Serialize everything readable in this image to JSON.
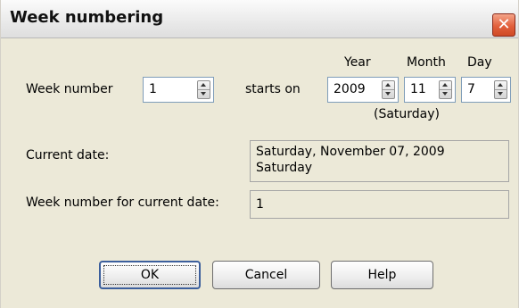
{
  "window": {
    "title": "Week numbering",
    "close_symbol": "✕"
  },
  "week_number": {
    "label": "Week number",
    "value": "1"
  },
  "start": {
    "label": "starts on",
    "year_header": "Year",
    "month_header": "Month",
    "day_header": "Day",
    "year": "2009",
    "month": "11",
    "day": "7",
    "weekday": "(Saturday)"
  },
  "current_date": {
    "label": "Current date:",
    "line1": "Saturday, November 07, 2009",
    "line2": "Saturday"
  },
  "current_week": {
    "label": "Week number for current date:",
    "value": "1"
  },
  "buttons": {
    "ok": "OK",
    "cancel": "Cancel",
    "help": "Help"
  }
}
